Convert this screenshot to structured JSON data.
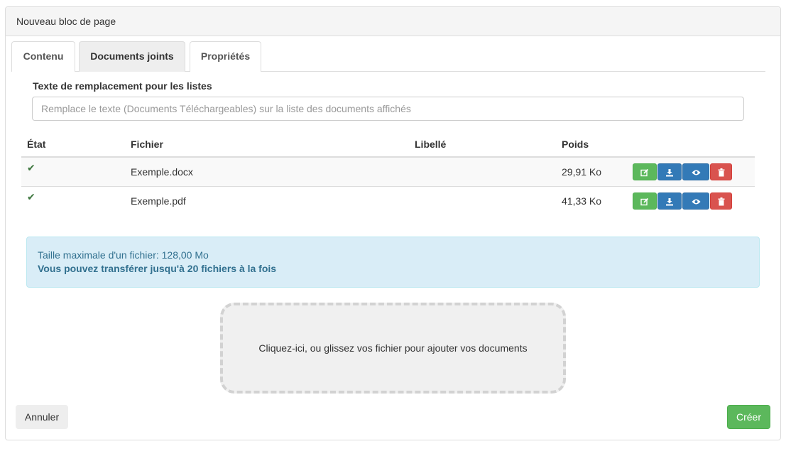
{
  "panel": {
    "title": "Nouveau bloc de page"
  },
  "tabs": [
    {
      "label": "Contenu",
      "active": false
    },
    {
      "label": "Documents joints",
      "active": true
    },
    {
      "label": "Propriétés",
      "active": false
    }
  ],
  "replacement": {
    "label": "Texte de remplacement pour les listes",
    "value": "",
    "placeholder": "Remplace le texte (Documents Téléchargeables) sur la liste des documents affichés"
  },
  "table": {
    "headers": {
      "state": "État",
      "file": "Fichier",
      "label": "Libellé",
      "size": "Poids"
    },
    "rows": [
      {
        "state": "✔",
        "file": "Exemple.docx",
        "label": "",
        "size": "29,91 Ko"
      },
      {
        "state": "✔",
        "file": "Exemple.pdf",
        "label": "",
        "size": "41,33 Ko"
      }
    ],
    "action_icons": [
      "edit-icon",
      "download-icon",
      "eye-icon",
      "trash-icon"
    ]
  },
  "alert": {
    "line1": "Taille maximale d'un fichier: 128,00 Mo",
    "line2": "Vous pouvez transférer jusqu'à 20 fichiers à la fois"
  },
  "dropzone": {
    "text": "Cliquez-ici, ou glissez vos fichier pour ajouter vos documents"
  },
  "footer": {
    "cancel_label": "Annuler",
    "create_label": "Créer"
  },
  "colors": {
    "success": "#5cb85c",
    "primary": "#337ab7",
    "danger": "#d9534f",
    "info_bg": "#d9edf7",
    "info_text": "#31708f"
  }
}
